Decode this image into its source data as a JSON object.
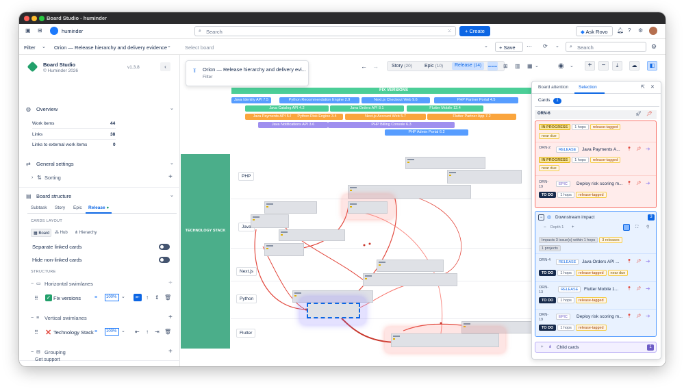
{
  "window": {
    "title": "Board Studio - huminder"
  },
  "topbar": {
    "workspace": "huminder",
    "search_placeholder": "Search",
    "create_label": "Create",
    "ask_rovo_label": "Ask Rovo"
  },
  "filterbar": {
    "filter_label": "Filter",
    "board_name": "Orion — Release hierarchy and delivery evidence",
    "select_board_placeholder": "Select board",
    "save_label": "Save",
    "search_placeholder": "Search"
  },
  "sidebar": {
    "app_name": "Board Studio",
    "app_sub": "© Huminder 2026",
    "version": "v1.3.8",
    "overview_label": "Overview",
    "stats": [
      {
        "label": "Work items",
        "value": "44"
      },
      {
        "label": "Links",
        "value": "38"
      },
      {
        "label": "Links to external work items",
        "value": "0"
      }
    ],
    "general_settings_label": "General settings",
    "sorting_label": "Sorting",
    "board_structure_label": "Board structure",
    "tabs": [
      "Subtask",
      "Story",
      "Epic",
      "Release"
    ],
    "cards_layout_label": "CARDS LAYOUT",
    "layout_options": [
      "Board",
      "Hub",
      "Hierarchy"
    ],
    "separate_linked_label": "Separate linked cards",
    "hide_nonlinked_label": "Hide non-linked cards",
    "structure_label": "STRUCTURE",
    "horizontal_label": "Horizontal swimlanes",
    "fix_versions_label": "Fix versions",
    "fix_versions_zoom": "100%",
    "vertical_label": "Vertical swimlanes",
    "tech_stack_label": "Technology Stack",
    "tech_stack_zoom": "100%",
    "grouping_label": "Grouping",
    "support_label": "Get support"
  },
  "popup": {
    "title": "Orion — Release hierarchy and delivery evi...",
    "subtitle": "Filter"
  },
  "toolbar": {
    "story_label": "Story",
    "story_count": "(20)",
    "epic_label": "Epic",
    "epic_count": "(10)",
    "release_label": "Release",
    "release_count": "(14)"
  },
  "board": {
    "fix_versions_header": "FIX VERSIONS",
    "tech_stack_label": "TECHNOLOGY STACK",
    "releases": [
      "Java Identity API 7.5",
      "Python Recommendation Engine 2.9",
      "Next.js Checkout Web 9.6",
      "PHP Partner Portal 4.5",
      "Java Catalog API 4.2",
      "Java Orders API 8.1",
      "Flutter Mobile 12.4",
      "Java Payments API 5.6",
      "Python Risk Engine 3.4",
      "Next.js Account Web 5.7",
      "Flutter Partner App 7.2",
      "Java Notifications API 3.6",
      "PHP Billing Console 6.3",
      "PHP Admin Portal 6.2"
    ],
    "lanes": [
      "PHP",
      "Java",
      "Next.js",
      "Python",
      "Flutter"
    ]
  },
  "panel": {
    "tabs": [
      "Board attention",
      "Selection"
    ],
    "cards_label": "Cards",
    "cards_count": "1",
    "selected_key": "ORN-6",
    "cards": [
      {
        "key": "ORN-2",
        "type": "RELEASE",
        "title": "Java Payments A...",
        "status": "IN PROGRESS",
        "hops": "1 hops",
        "tag": "release-tagged",
        "due": "near due"
      },
      {
        "key": "ORN-19",
        "type": "EPIC",
        "title": "Deploy risk scoring m...",
        "status": "TO DO",
        "hops": "1 hops",
        "tag": "release-tagged"
      }
    ],
    "top_status": "IN PROGRESS",
    "top_hops": "1 hops",
    "top_tag": "release-tagged",
    "top_due": "near due",
    "downstream_label": "Downstream impact",
    "downstream_count": "3",
    "depth_label": "Depth 1",
    "impacts_text": "Impacts 3 issue(s) within 1 hops",
    "releases_text": "3 releases",
    "projects_text": "1 projects",
    "downstream_cards": [
      {
        "key": "ORN-4",
        "type": "RELEASE",
        "title": "Java Orders API ...",
        "status": "TO DO",
        "hops": "1 hops",
        "tag": "release-tagged",
        "due": "near due"
      },
      {
        "key": "ORN-13",
        "type": "RELEASE",
        "title": "Flutter Mobile 1...",
        "status": "TO DO",
        "hops": "1 hops",
        "tag": "release-tagged"
      },
      {
        "key": "ORN-19",
        "type": "EPIC",
        "title": "Deploy risk scoring m...",
        "status": "TO DO",
        "hops": "1 hops",
        "tag": "release-tagged"
      }
    ],
    "child_cards_label": "Child cards",
    "child_cards_count": "1"
  }
}
